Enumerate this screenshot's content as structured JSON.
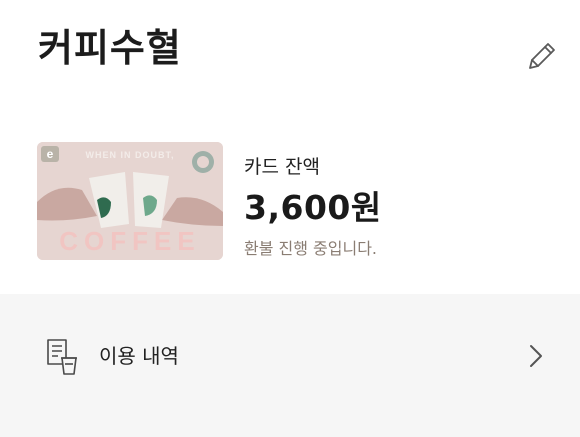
{
  "header": {
    "title": "커피수혈",
    "edit_icon": "pencil-icon"
  },
  "card": {
    "image_text_top": "WHEN IN DOUBT,",
    "image_text_bottom": "COFFEE",
    "image_badge": "e",
    "balance_label": "카드 잔액",
    "balance_amount": "3,600원",
    "status": "환불 진행 중입니다."
  },
  "menu": {
    "items": [
      {
        "label": "이용 내역",
        "icon": "receipt-cup-icon",
        "chevron": "chevron-right-icon"
      }
    ]
  },
  "colors": {
    "card_bg": "#e7d6d2",
    "status_text": "#8a7d73",
    "menu_bg": "#f6f6f6"
  }
}
